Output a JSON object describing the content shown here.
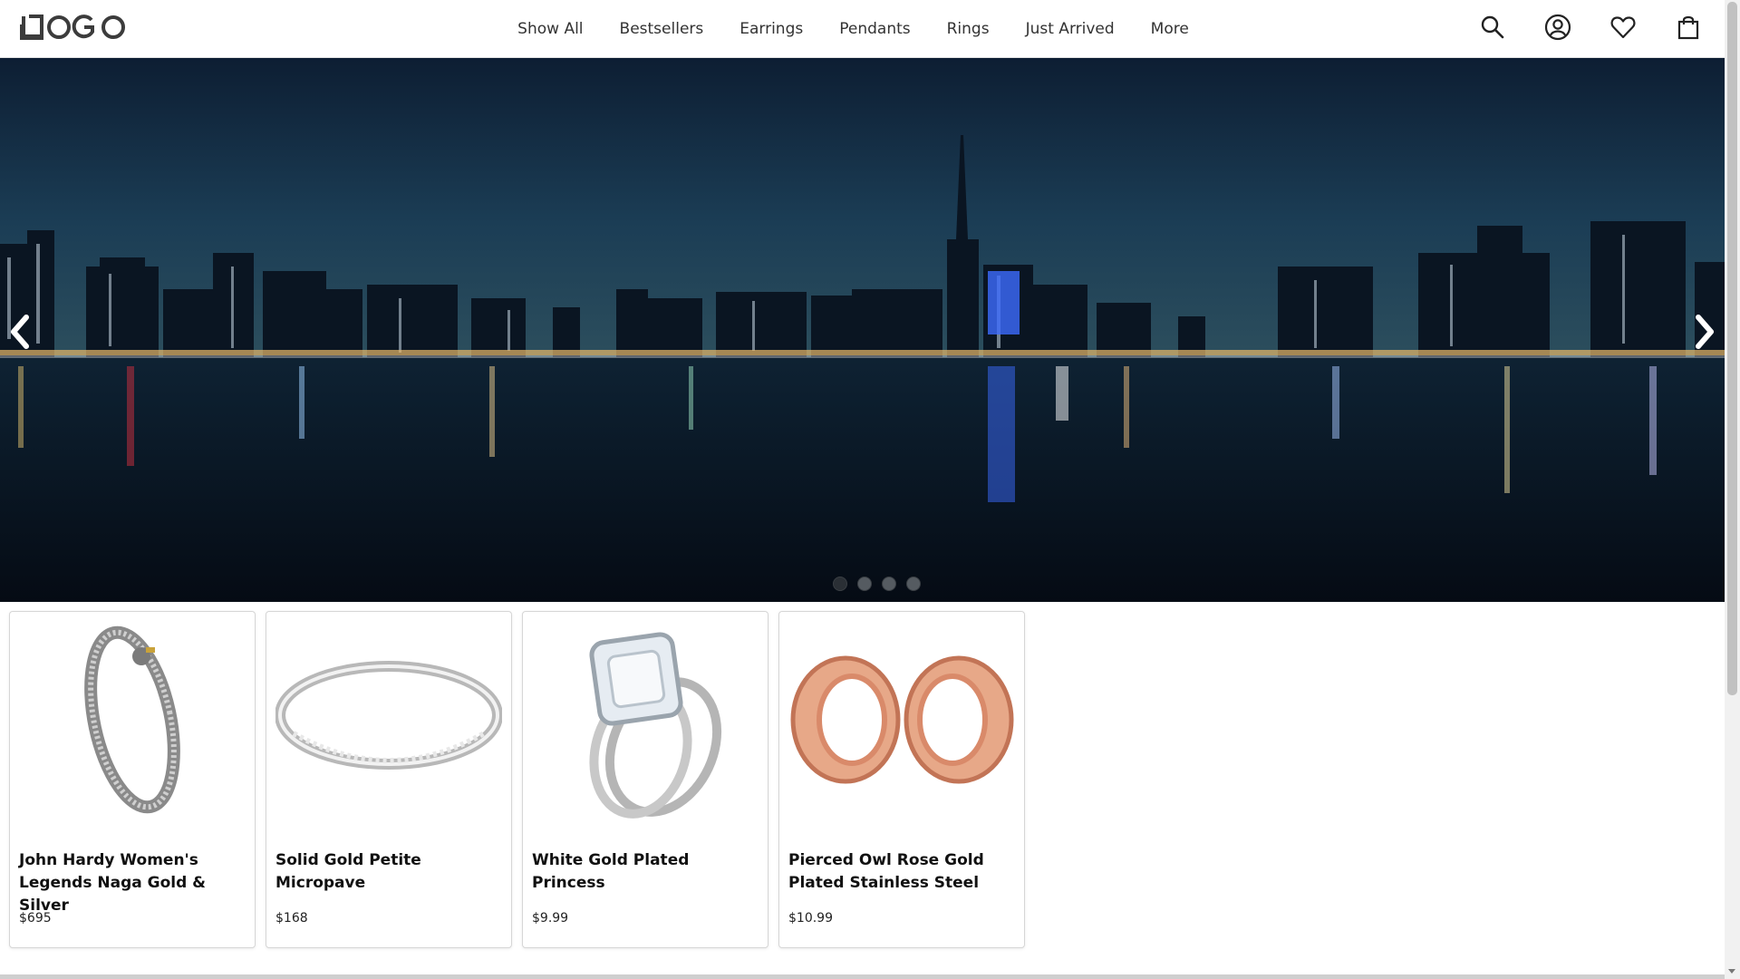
{
  "brand": {
    "logo_text": "LOGO"
  },
  "nav": {
    "items": [
      {
        "label": "Show All"
      },
      {
        "label": "Bestsellers"
      },
      {
        "label": "Earrings"
      },
      {
        "label": "Pendants"
      },
      {
        "label": "Rings"
      },
      {
        "label": "Just Arrived"
      },
      {
        "label": "More"
      }
    ]
  },
  "header_icons": [
    "search-icon",
    "account-icon",
    "heart-icon",
    "bag-icon"
  ],
  "carousel": {
    "slide_count": 4,
    "active_index": 0,
    "prev_icon": "chevron-left-icon",
    "next_icon": "chevron-right-icon"
  },
  "products": [
    {
      "title": "John Hardy Women's Legends Naga Gold & Silver",
      "price": "$695"
    },
    {
      "title": "Solid Gold Petite Micropave",
      "price": "$168"
    },
    {
      "title": "White Gold Plated Princess",
      "price": "$9.99"
    },
    {
      "title": "Pierced Owl Rose Gold Plated Stainless Steel",
      "price": "$10.99"
    }
  ],
  "colors": {
    "accent_text": "#222222",
    "hero_sky": "#13304a",
    "hero_water": "#06101c",
    "rose_gold": "#d98a6a"
  }
}
